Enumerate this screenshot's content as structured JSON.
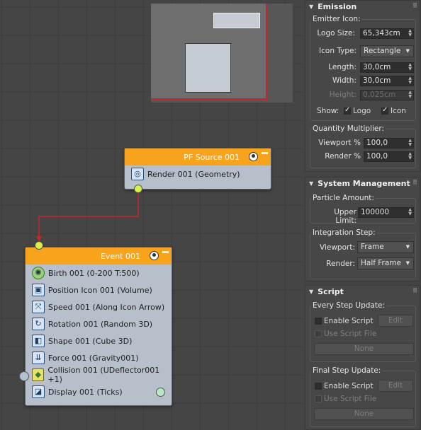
{
  "pf_source": {
    "title": "PF Source 001",
    "operators": [
      {
        "icon": "teapot-icon",
        "glyph": "◎",
        "label": "Render 001 (Geometry)"
      }
    ]
  },
  "event": {
    "title": "Event 001",
    "operators": [
      {
        "icon": "birth-icon",
        "glyph": "✺",
        "label": "Birth 001 (0-200 T:500)"
      },
      {
        "icon": "position-icon",
        "glyph": "▣",
        "label": "Position Icon 001 (Volume)"
      },
      {
        "icon": "speed-icon",
        "glyph": "⤧",
        "label": "Speed 001 (Along Icon Arrow)"
      },
      {
        "icon": "rotation-icon",
        "glyph": "↻",
        "label": "Rotation 001 (Random 3D)"
      },
      {
        "icon": "shape-icon",
        "glyph": "◧",
        "label": "Shape 001 (Cube 3D)"
      },
      {
        "icon": "force-icon",
        "glyph": "⇊",
        "label": "Force 001 (Gravity001)"
      },
      {
        "icon": "collision-icon",
        "glyph": "◆",
        "label": "Collision 001 (UDeflector001 +1)"
      },
      {
        "icon": "display-icon",
        "glyph": "◪",
        "label": "Display 001 (Ticks)"
      }
    ]
  },
  "emission": {
    "title": "Emission",
    "emitter_icon_label": "Emitter Icon:",
    "logo_size_label": "Logo Size:",
    "logo_size_value": "65,343cm",
    "icon_type_label": "Icon Type:",
    "icon_type_value": "Rectangle",
    "length_label": "Length:",
    "length_value": "30,0cm",
    "width_label": "Width:",
    "width_value": "30,0cm",
    "height_label": "Height:",
    "height_value": "0,025cm",
    "show_label": "Show:",
    "logo_check": "Logo",
    "icon_check": "Icon",
    "quantity_label": "Quantity Multiplier:",
    "viewport_label": "Viewport %",
    "viewport_value": "100,0",
    "render_label": "Render %",
    "render_value": "100,0"
  },
  "system": {
    "title": "System Management",
    "particle_amount_label": "Particle Amount:",
    "upper_limit_label": "Upper Limit:",
    "upper_limit_value": "100000",
    "integration_label": "Integration Step:",
    "viewport_label": "Viewport:",
    "viewport_value": "Frame",
    "render_label": "Render:",
    "render_value": "Half Frame"
  },
  "script": {
    "title": "Script",
    "every_step_label": "Every Step Update:",
    "final_step_label": "Final Step Update:",
    "enable_script": "Enable Script",
    "use_script_file": "Use Script File",
    "edit": "Edit",
    "none": "None"
  },
  "colors": {
    "node_title": "#f7a41c",
    "wire": "#c0282a",
    "node_body": "#b7c0ca"
  }
}
